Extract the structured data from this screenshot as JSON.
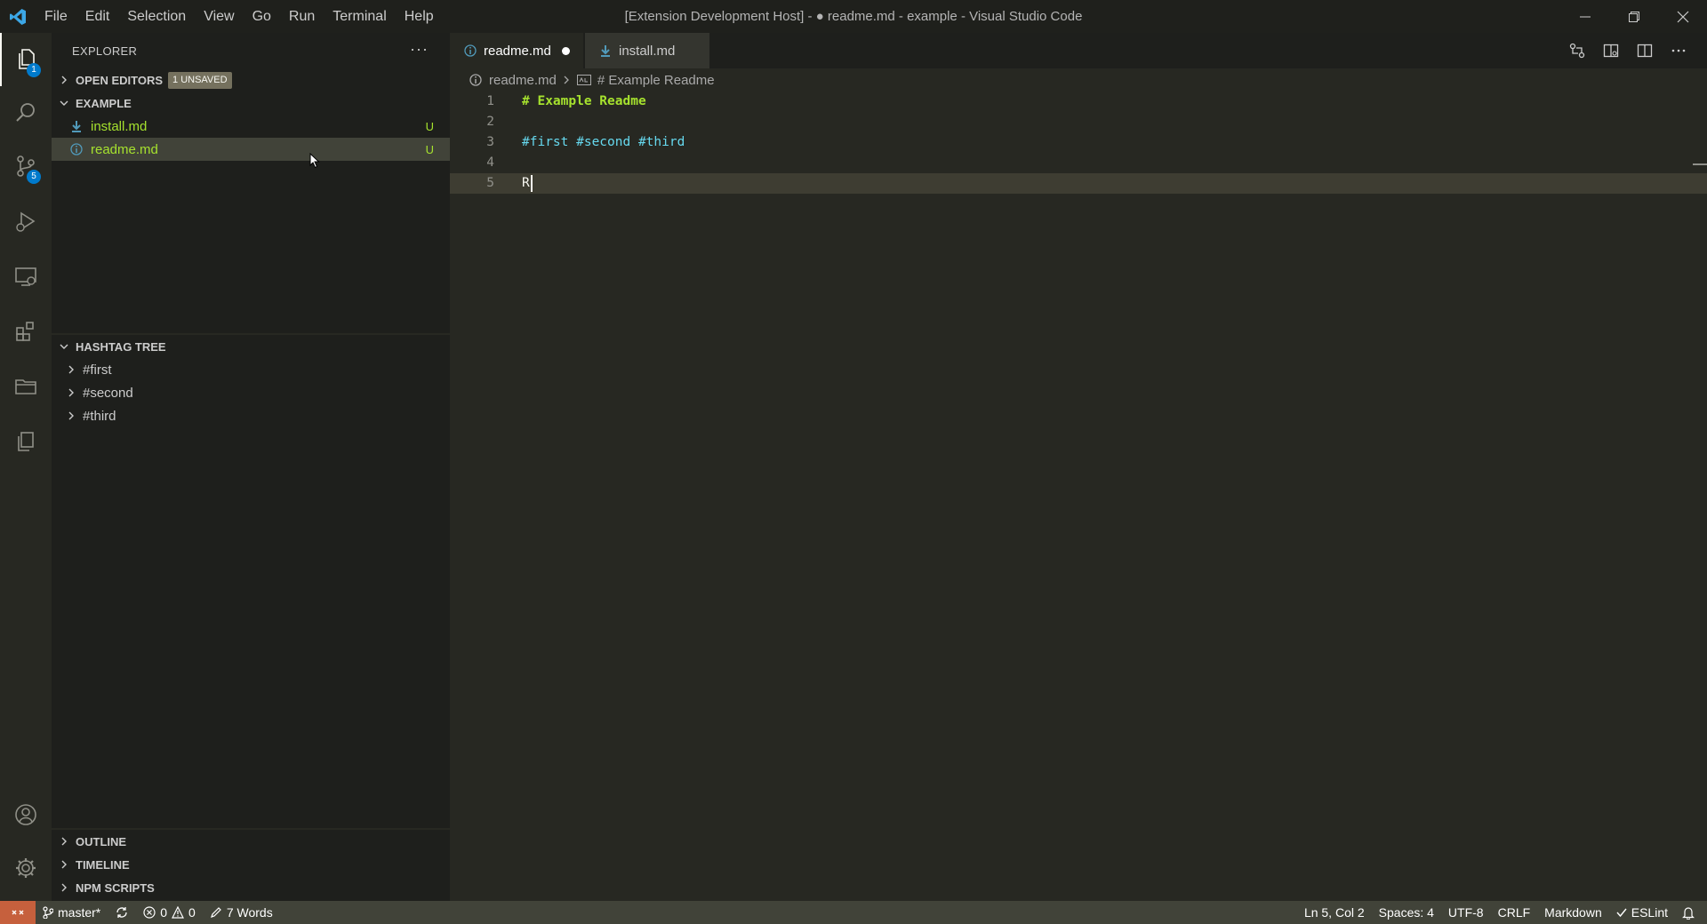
{
  "titlebar": {
    "menu": [
      "File",
      "Edit",
      "Selection",
      "View",
      "Go",
      "Run",
      "Terminal",
      "Help"
    ],
    "window_title": "[Extension Development Host] - ● readme.md - example - Visual Studio Code"
  },
  "activitybar": {
    "explorer_badge": "1",
    "scm_badge": "5"
  },
  "sidebar": {
    "title": "EXPLORER",
    "open_editors": {
      "label": "OPEN EDITORS",
      "badge": "1 UNSAVED"
    },
    "folder": {
      "label": "EXAMPLE",
      "files": [
        {
          "name": "install.md",
          "status": "U"
        },
        {
          "name": "readme.md",
          "status": "U"
        }
      ]
    },
    "hashtag_tree": {
      "label": "HASHTAG TREE",
      "items": [
        "#first",
        "#second",
        "#third"
      ]
    },
    "bottom_sections": [
      "OUTLINE",
      "TIMELINE",
      "NPM SCRIPTS"
    ]
  },
  "editor": {
    "tabs": [
      {
        "label": "readme.md",
        "dirty": true,
        "active": true
      },
      {
        "label": "install.md",
        "dirty": false,
        "active": false
      }
    ],
    "breadcrumb": {
      "file": "readme.md",
      "symbol": "# Example Readme"
    },
    "lines": [
      {
        "num": "1",
        "text": "# Example Readme"
      },
      {
        "num": "2",
        "text": ""
      },
      {
        "num": "3",
        "text": "#first #second #third"
      },
      {
        "num": "4",
        "text": ""
      },
      {
        "num": "5",
        "text": "R"
      }
    ]
  },
  "statusbar": {
    "branch": "master*",
    "errors": "0",
    "warnings": "0",
    "words": "7 Words",
    "position": "Ln 5, Col 2",
    "spaces": "Spaces: 4",
    "encoding": "UTF-8",
    "eol": "CRLF",
    "language": "Markdown",
    "eslint": "ESLint"
  },
  "colors": {
    "accent_green": "#a6e22e",
    "accent_blue": "#66d9ef",
    "badge_blue": "#007acc",
    "remote_orange": "#c6603d",
    "statusbar_bg": "#414339"
  }
}
